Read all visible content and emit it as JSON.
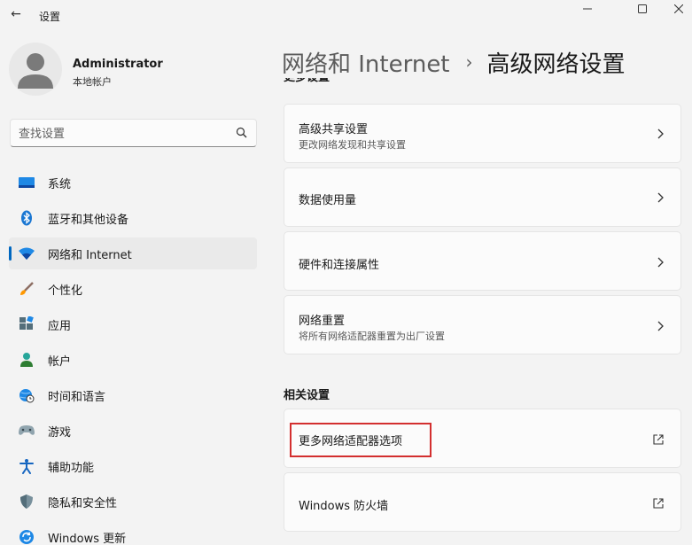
{
  "app": {
    "title": "设置",
    "back_glyph": "←"
  },
  "profile": {
    "name": "Administrator",
    "account_type": "本地帐户"
  },
  "search": {
    "placeholder": "查找设置"
  },
  "nav": {
    "items": [
      {
        "label": "系统",
        "icon": "system-icon"
      },
      {
        "label": "蓝牙和其他设备",
        "icon": "bluetooth-icon"
      },
      {
        "label": "网络和 Internet",
        "icon": "wifi-icon",
        "active": true
      },
      {
        "label": "个性化",
        "icon": "brush-icon"
      },
      {
        "label": "应用",
        "icon": "apps-icon"
      },
      {
        "label": "帐户",
        "icon": "person-icon"
      },
      {
        "label": "时间和语言",
        "icon": "globe-clock-icon"
      },
      {
        "label": "游戏",
        "icon": "gamepad-icon"
      },
      {
        "label": "辅助功能",
        "icon": "accessibility-icon"
      },
      {
        "label": "隐私和安全性",
        "icon": "shield-icon"
      },
      {
        "label": "Windows 更新",
        "icon": "update-icon"
      }
    ]
  },
  "breadcrumb": {
    "parent": "网络和 Internet",
    "separator": "›",
    "current": "高级网络设置"
  },
  "sections": {
    "more_settings_title": "更多设置",
    "related_title": "相关设置"
  },
  "cards": {
    "advanced_sharing": {
      "title": "高级共享设置",
      "subtitle": "更改网络发现和共享设置"
    },
    "data_usage": {
      "title": "数据使用量"
    },
    "hardware_props": {
      "title": "硬件和连接属性"
    },
    "network_reset": {
      "title": "网络重置",
      "subtitle": "将所有网络适配器重置为出厂设置"
    },
    "more_adapter": {
      "title": "更多网络适配器选项"
    },
    "firewall": {
      "title": "Windows 防火墙"
    }
  },
  "colors": {
    "accent": "#0067c0",
    "highlight_border": "#d32f2f",
    "window_bg": "#f3f3f3",
    "card_bg": "#fbfbfb"
  }
}
